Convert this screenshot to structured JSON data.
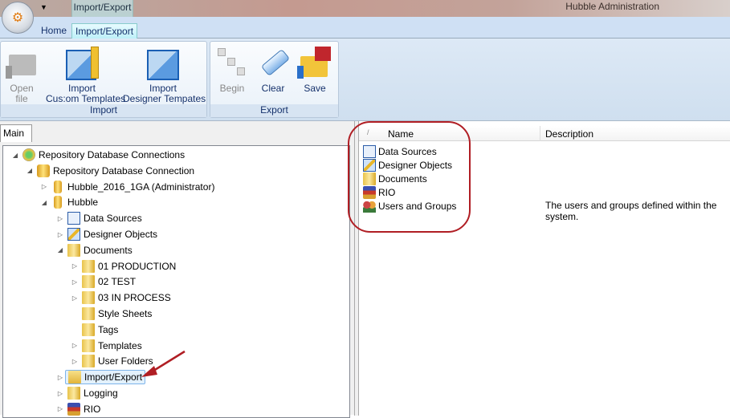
{
  "titlebar": {
    "app_title": "Hubble Administration",
    "context_tab": "Import/Export",
    "qat_icon": "dropdown-arrow-icon"
  },
  "tabs": [
    {
      "label": "Home"
    },
    {
      "label": "Import/Export",
      "active": true
    }
  ],
  "ribbon": {
    "import_group": {
      "label": "Import",
      "buttons": [
        {
          "label": "Open file",
          "enabled": false,
          "icon": "open-folder-icon"
        },
        {
          "label": "Import\nCus:om Templates",
          "icon": "template-ruler-icon"
        },
        {
          "label": "Import\nDesigner Tempates",
          "icon": "template-icon"
        }
      ]
    },
    "export_group": {
      "label": "Export",
      "buttons": [
        {
          "label": "Begin",
          "enabled": false,
          "icon": "tree-icon"
        },
        {
          "label": "Clear",
          "icon": "eraser-icon"
        },
        {
          "label": "Save",
          "icon": "save-folder-icon"
        }
      ]
    }
  },
  "left_panel": {
    "tab": "Main",
    "tree": [
      {
        "label": "Repository Database Connections",
        "level": 0,
        "exp": "expanded",
        "icon": "network-db"
      },
      {
        "label": "Repository Database Connection",
        "level": 1,
        "exp": "expanded",
        "icon": "db-multi"
      },
      {
        "label": "Hubble_2016_1GA (Administrator)",
        "level": 2,
        "exp": "collapsed",
        "icon": "db"
      },
      {
        "label": "Hubble",
        "level": 2,
        "exp": "expanded",
        "icon": "db"
      },
      {
        "label": "Data Sources",
        "level": 3,
        "exp": "collapsed",
        "icon": "datasource"
      },
      {
        "label": "Designer Objects",
        "level": 3,
        "exp": "collapsed",
        "icon": "wrench"
      },
      {
        "label": "Documents",
        "level": 3,
        "exp": "expanded",
        "icon": "folder"
      },
      {
        "label": "01 PRODUCTION",
        "level": 4,
        "exp": "collapsed",
        "icon": "folder"
      },
      {
        "label": "02 TEST",
        "level": 4,
        "exp": "collapsed",
        "icon": "folder"
      },
      {
        "label": "03 IN PROCESS",
        "level": 4,
        "exp": "collapsed",
        "icon": "folder"
      },
      {
        "label": "Style Sheets",
        "level": 4,
        "exp": "none",
        "icon": "folder"
      },
      {
        "label": "Tags",
        "level": 4,
        "exp": "none",
        "icon": "folder"
      },
      {
        "label": "Templates",
        "level": 4,
        "exp": "collapsed",
        "icon": "folder"
      },
      {
        "label": "User Folders",
        "level": 4,
        "exp": "collapsed",
        "icon": "folder"
      },
      {
        "label": "Import/Export",
        "level": 3,
        "exp": "collapsed",
        "icon": "open-folder",
        "selected": true
      },
      {
        "label": "Logging",
        "level": 3,
        "exp": "collapsed",
        "icon": "folder"
      },
      {
        "label": "RIO",
        "level": 3,
        "exp": "collapsed",
        "icon": "books"
      }
    ]
  },
  "list": {
    "columns": [
      "Name",
      "Description"
    ],
    "sort_indicator": "/",
    "rows": [
      {
        "name": "Data Sources",
        "description": "",
        "icon": "datasource"
      },
      {
        "name": "Designer Objects",
        "description": "",
        "icon": "wrench"
      },
      {
        "name": "Documents",
        "description": "",
        "icon": "folder"
      },
      {
        "name": "RIO",
        "description": "",
        "icon": "books"
      },
      {
        "name": "Users and Groups",
        "description": "The users and groups defined within the system.",
        "icon": "users"
      }
    ]
  },
  "annotations": {
    "color": "#b01e24"
  }
}
